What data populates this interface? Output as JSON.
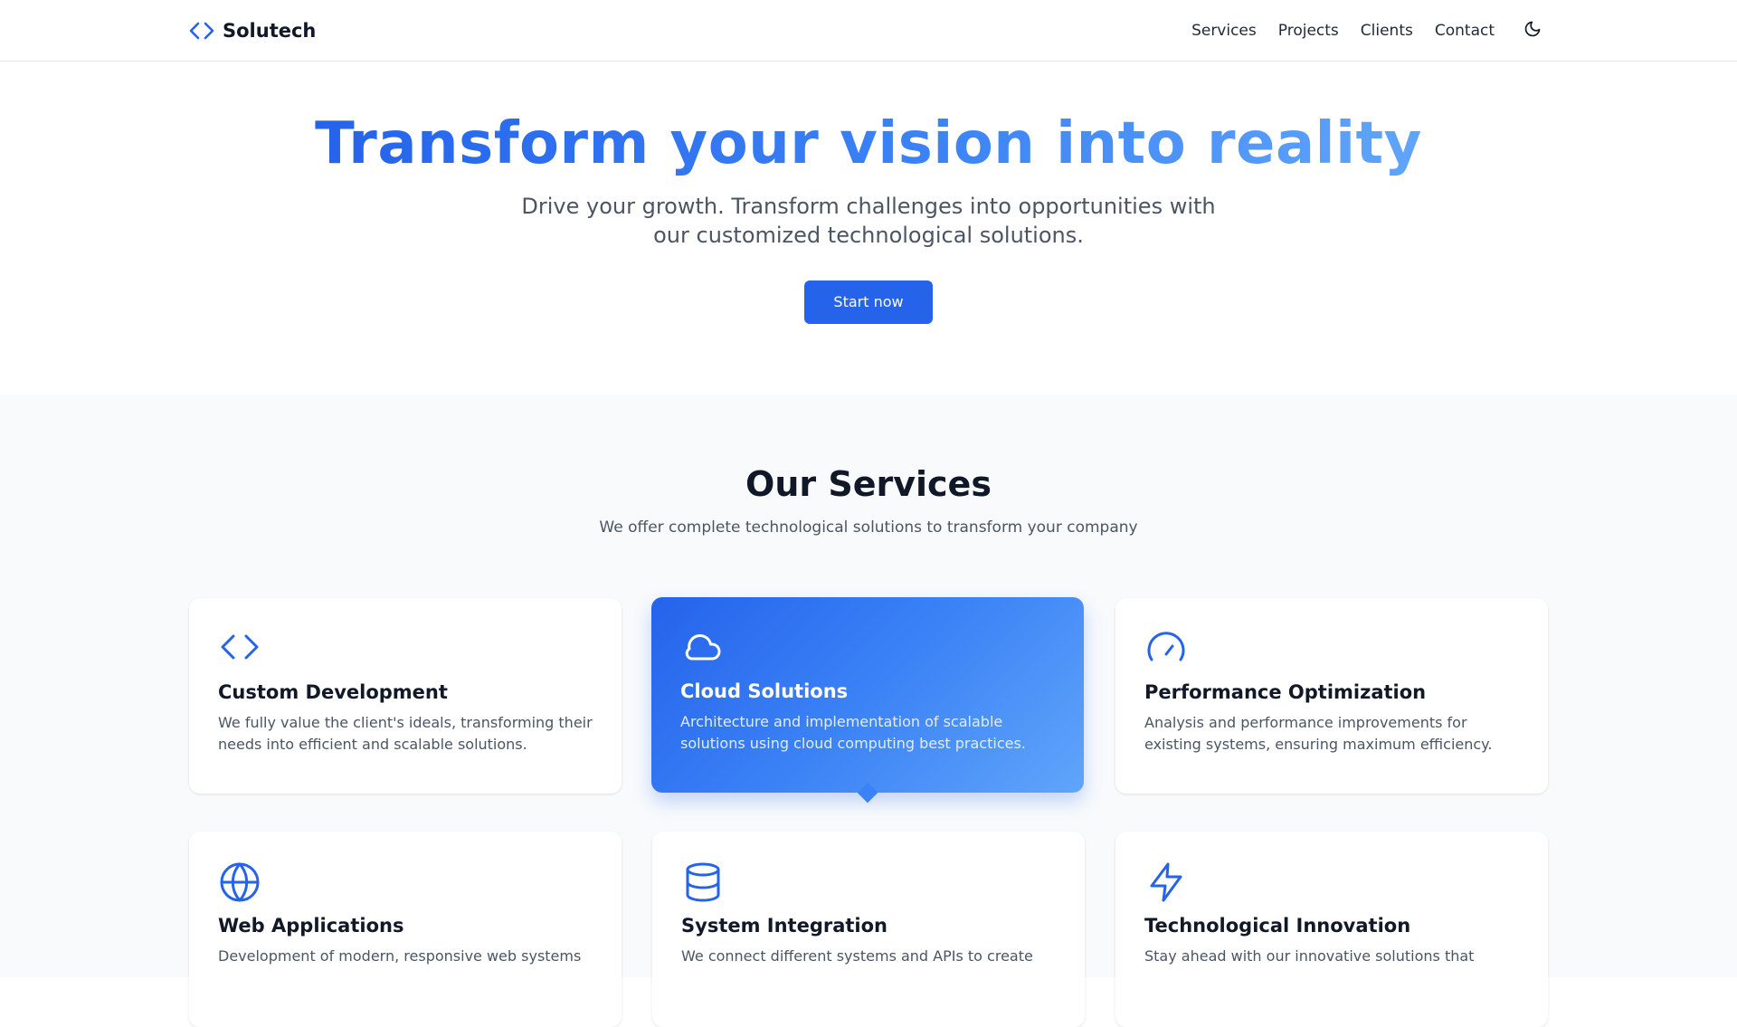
{
  "header": {
    "brand": "Solutech",
    "nav": [
      "Services",
      "Projects",
      "Clients",
      "Contact"
    ],
    "brand_icon": "code-brackets-icon",
    "theme_toggle_icon": "moon-icon"
  },
  "hero": {
    "title": "Transform your vision into reality",
    "subtitle": "Drive your growth. Transform challenges into opportunities with our customized technological solutions.",
    "cta": "Start now"
  },
  "services": {
    "title": "Our Services",
    "subtitle": "We offer complete technological solutions to transform your company",
    "cards": [
      {
        "icon": "code-brackets-icon",
        "title": "Custom Development",
        "desc": "We fully value the client's ideals, transforming their needs into efficient and scalable solutions.",
        "active": false
      },
      {
        "icon": "cloud-icon",
        "title": "Cloud Solutions",
        "desc": "Architecture and implementation of scalable solutions using cloud computing best practices.",
        "active": true
      },
      {
        "icon": "gauge-icon",
        "title": "Performance Optimization",
        "desc": "Analysis and performance improvements for existing systems, ensuring maximum efficiency.",
        "active": false
      },
      {
        "icon": "globe-icon",
        "title": "Web Applications",
        "desc": "Development of modern, responsive web systems",
        "active": false
      },
      {
        "icon": "database-icon",
        "title": "System Integration",
        "desc": "We connect different systems and APIs to create",
        "active": false
      },
      {
        "icon": "lightning-icon",
        "title": "Technological Innovation",
        "desc": "Stay ahead with our innovative solutions that",
        "active": false
      }
    ]
  },
  "colors": {
    "accent": "#2563eb",
    "accent_light": "#60a5fa",
    "services_bg": "#f8fafc"
  }
}
